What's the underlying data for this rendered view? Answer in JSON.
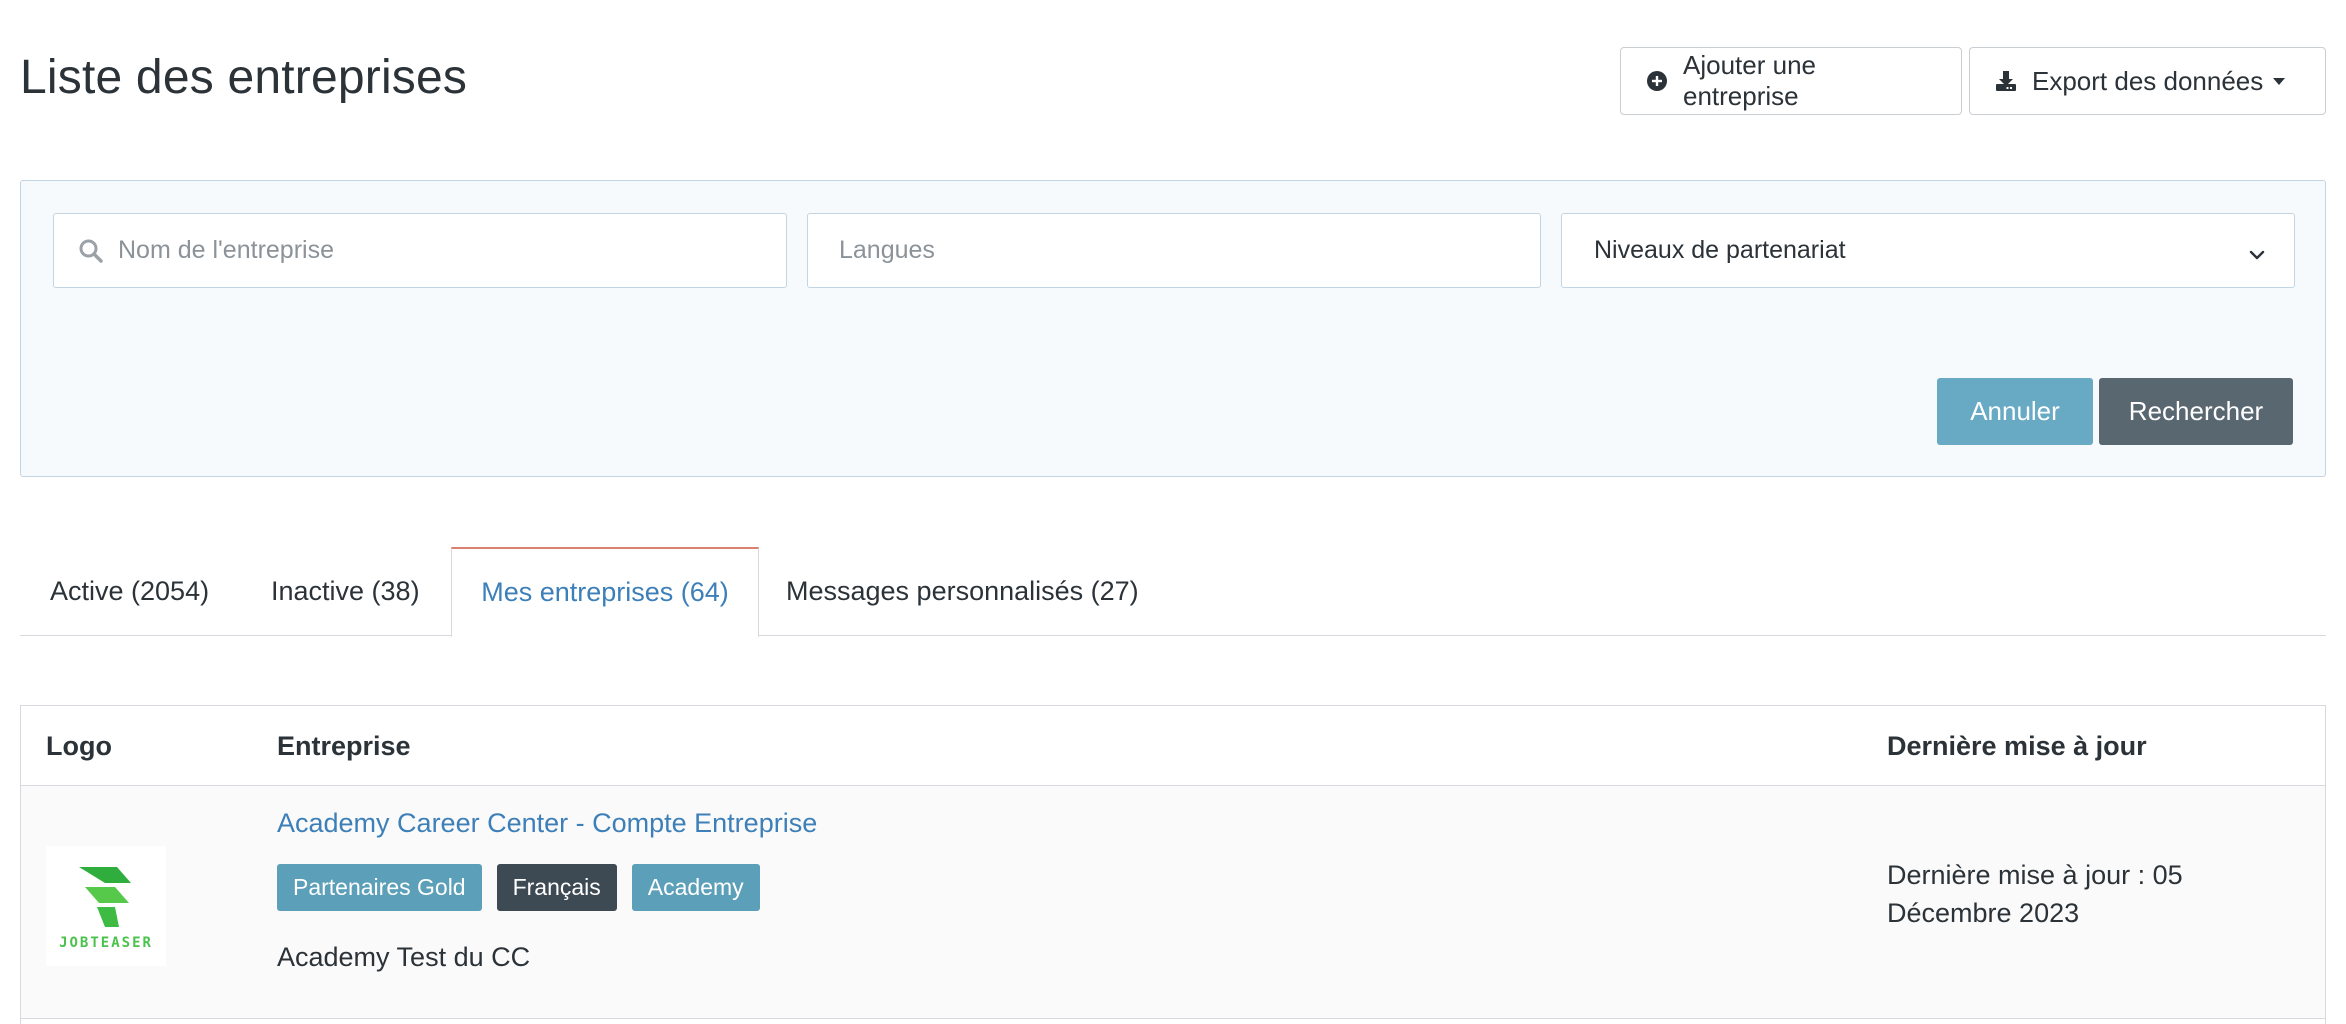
{
  "page": {
    "title": "Liste des entreprises"
  },
  "header_actions": {
    "add_label": "Ajouter une entreprise",
    "export_label": "Export des données"
  },
  "filters": {
    "name_placeholder": "Nom de l'entreprise",
    "languages_placeholder": "Langues",
    "partnership_label": "Niveaux de partenariat",
    "cancel_label": "Annuler",
    "search_label": "Rechercher"
  },
  "tabs": [
    {
      "label": "Active (2054)",
      "active": false
    },
    {
      "label": "Inactive (38)",
      "active": false
    },
    {
      "label": "Mes entreprises (64)",
      "active": true
    },
    {
      "label": "Messages personnalisés (27)",
      "active": false
    }
  ],
  "table": {
    "headers": {
      "logo": "Logo",
      "company": "Entreprise",
      "updated": "Dernière mise à jour"
    },
    "rows": [
      {
        "logo_text": "JOBTEASER",
        "name": "Academy Career Center - Compte Entreprise",
        "badges": [
          "Partenaires Gold",
          "Français",
          "Academy"
        ],
        "description": "Academy Test du CC",
        "updated": "Dernière mise à jour : 05 Décembre 2023"
      }
    ]
  },
  "colors": {
    "link": "#3d7fb8",
    "cancel_button": "#68a9c4",
    "search_button": "#586770",
    "active_tab_accent": "#d9816e",
    "badge_blue": "#5b9fb9",
    "badge_dark": "#3e4a53",
    "logo_green": "#4bc24b"
  }
}
